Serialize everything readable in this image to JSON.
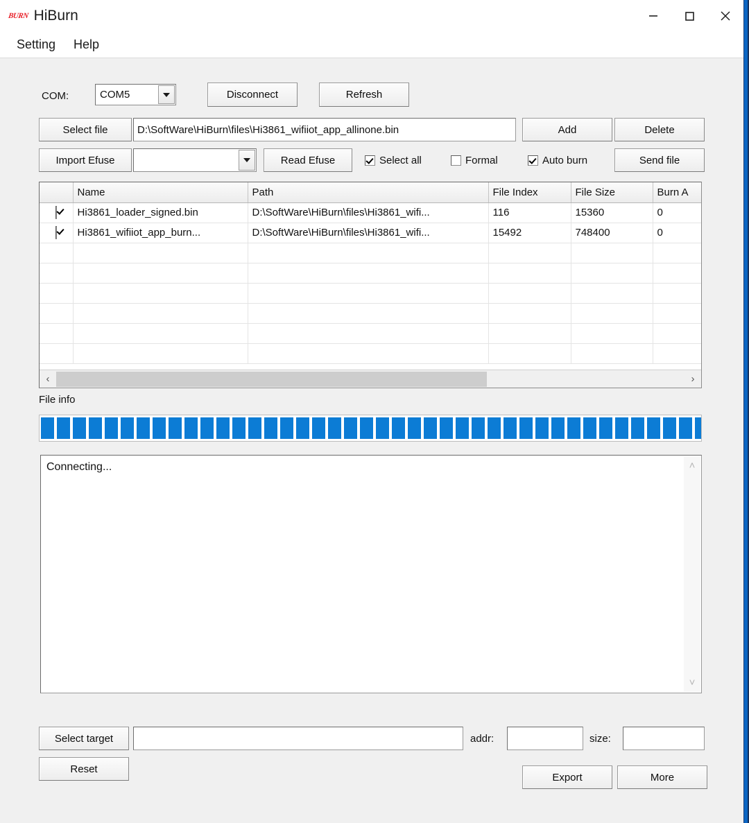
{
  "window": {
    "logo_text": "BURN",
    "title": "HiBurn",
    "logo_color": "#e8212a",
    "controls": {
      "minimize": "minimize-icon",
      "maximize": "maximize-icon",
      "close": "close-icon"
    }
  },
  "menu": {
    "items": [
      {
        "label": "Setting"
      },
      {
        "label": "Help"
      }
    ]
  },
  "toolbar": {
    "com_label": "COM:",
    "com_value": "COM5",
    "disconnect_label": "Disconnect",
    "refresh_label": "Refresh",
    "select_file_label": "Select file",
    "file_path_value": "D:\\SoftWare\\HiBurn\\files\\Hi3861_wifiiot_app_allinone.bin",
    "add_label": "Add",
    "delete_label": "Delete",
    "import_efuse_label": "Import Efuse",
    "efuse_value": "",
    "read_efuse_label": "Read Efuse",
    "select_all_label": "Select all",
    "select_all_checked": true,
    "formal_label": "Formal",
    "formal_checked": false,
    "auto_burn_label": "Auto burn",
    "auto_burn_checked": true,
    "send_file_label": "Send file"
  },
  "file_table": {
    "columns": [
      "",
      "Name",
      "Path",
      "File Index",
      "File Size",
      "Burn A"
    ],
    "rows": [
      {
        "checked": true,
        "name": "Hi3861_loader_signed.bin",
        "path": "D:\\SoftWare\\HiBurn\\files\\Hi3861_wifi...",
        "file_index": "116",
        "file_size": "15360",
        "burn_addr": "0"
      },
      {
        "checked": true,
        "name": "Hi3861_wifiiot_app_burn...",
        "path": "D:\\SoftWare\\HiBurn\\files\\Hi3861_wifi...",
        "file_index": "15492",
        "file_size": "748400",
        "burn_addr": "0"
      }
    ],
    "empty_row_count": 6,
    "hscroll_left_arrow": "‹",
    "hscroll_right_arrow": "›"
  },
  "progress": {
    "file_info_label": "File info",
    "segment_count": 45,
    "segment_color": "#0c7cd5",
    "percent": 100
  },
  "log": {
    "text": "Connecting...",
    "scroll_up_arrow": "˄",
    "scroll_down_arrow": "˅"
  },
  "bottom": {
    "select_target_label": "Select target",
    "target_value": "",
    "addr_label": "addr:",
    "addr_value": "",
    "size_label": "size:",
    "size_value": "",
    "reset_label": "Reset",
    "export_label": "Export",
    "more_label": "More"
  }
}
